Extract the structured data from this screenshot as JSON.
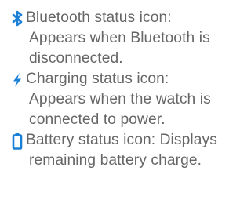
{
  "accent_color": "#1a7fd6",
  "text_color": "#666666",
  "items": [
    {
      "icon": "bluetooth-icon",
      "lines": [
        "Bluetooth status icon:",
        "Appears when Bluetooth is",
        "disconnected."
      ]
    },
    {
      "icon": "lightning-bolt-icon",
      "lines": [
        "Charging status icon:",
        "Appears when the watch is",
        "connected to power."
      ]
    },
    {
      "icon": "battery-icon",
      "lines": [
        "Battery status icon: Displays",
        "remaining battery charge."
      ]
    }
  ]
}
